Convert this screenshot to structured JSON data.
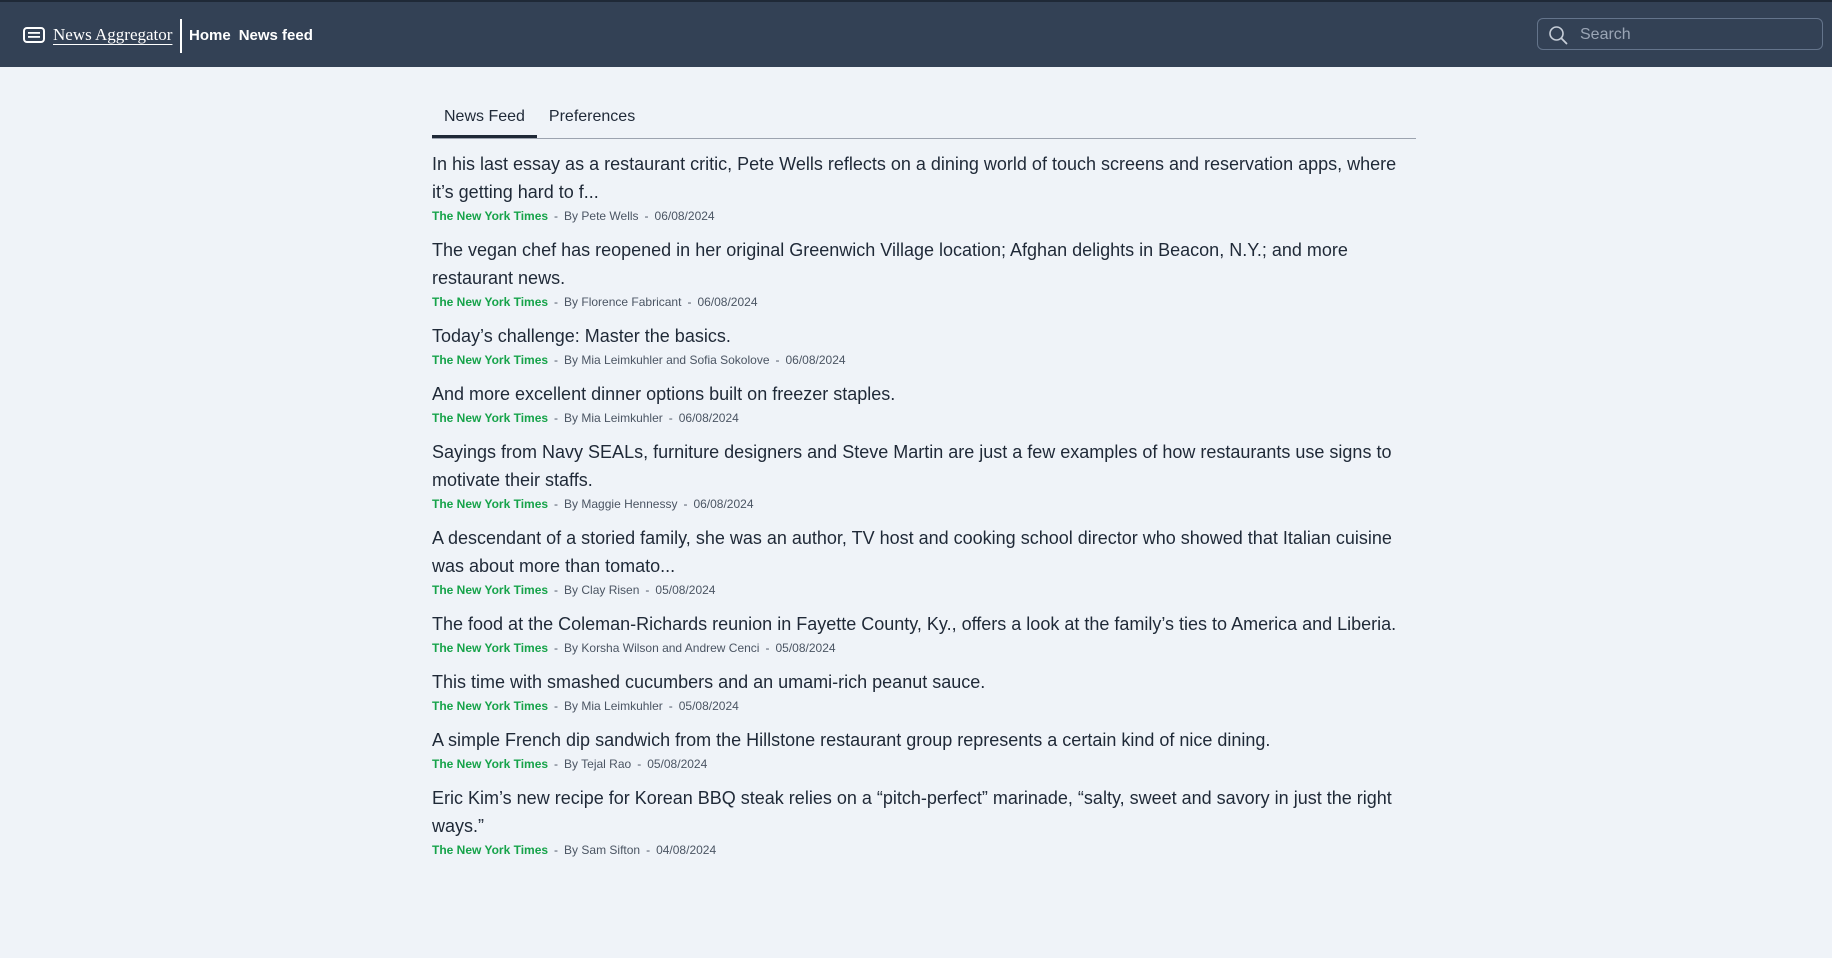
{
  "header": {
    "brand_icon": "newspaper-icon",
    "brand_label": "News Aggregator",
    "nav": [
      "Home",
      "News feed"
    ],
    "search_placeholder": "Search",
    "search_icon": "search-icon",
    "background_color": "#334155"
  },
  "tabs": [
    "News Feed",
    "Preferences"
  ],
  "active_tab": "News Feed",
  "articles": [
    {
      "headline": "In his last essay as a restaurant critic, Pete Wells reflects on a dining world of touch screens and reservation apps, where it’s getting hard to f...",
      "source": "The New York Times",
      "author": "By Pete Wells",
      "date": "06/08/2024"
    },
    {
      "headline": "The vegan chef has reopened in her original Greenwich Village location; Afghan delights in Beacon, N.Y.; and more restaurant news.",
      "source": "The New York Times",
      "author": "By Florence Fabricant",
      "date": "06/08/2024"
    },
    {
      "headline": "Today’s challenge: Master the basics.",
      "source": "The New York Times",
      "author": "By Mia Leimkuhler and Sofia Sokolove",
      "date": "06/08/2024"
    },
    {
      "headline": "And more excellent dinner options built on freezer staples.",
      "source": "The New York Times",
      "author": "By Mia Leimkuhler",
      "date": "06/08/2024"
    },
    {
      "headline": "Sayings from Navy SEALs, furniture designers and Steve Martin are just a few examples of how restaurants use signs to motivate their staffs.",
      "source": "The New York Times",
      "author": "By Maggie Hennessy",
      "date": "06/08/2024"
    },
    {
      "headline": "A descendant of a storied family, she was an author, TV host and cooking school director who showed that Italian cuisine was about more than tomato...",
      "source": "The New York Times",
      "author": "By Clay Risen",
      "date": "05/08/2024"
    },
    {
      "headline": "The food at the Coleman-Richards reunion in Fayette County, Ky., offers a look at the family’s ties to America and Liberia.",
      "source": "The New York Times",
      "author": "By Korsha Wilson and Andrew Cenci",
      "date": "05/08/2024"
    },
    {
      "headline": "This time with smashed cucumbers and an umami-rich peanut sauce.",
      "source": "The New York Times",
      "author": "By Mia Leimkuhler",
      "date": "05/08/2024"
    },
    {
      "headline": "A simple French dip sandwich from the Hillstone restaurant group represents a certain kind of nice dining.",
      "source": "The New York Times",
      "author": "By Tejal Rao",
      "date": "05/08/2024"
    },
    {
      "headline": "Eric Kim’s new recipe for Korean BBQ steak relies on a “pitch-perfect” marinade, “salty, sweet and savory in just the right ways.”",
      "source": "The New York Times",
      "author": "By Sam Sifton",
      "date": "04/08/2024"
    }
  ],
  "colors": {
    "source_accent": "#16a34a",
    "page_background": "#eff3f8",
    "text": "#1f2937"
  }
}
